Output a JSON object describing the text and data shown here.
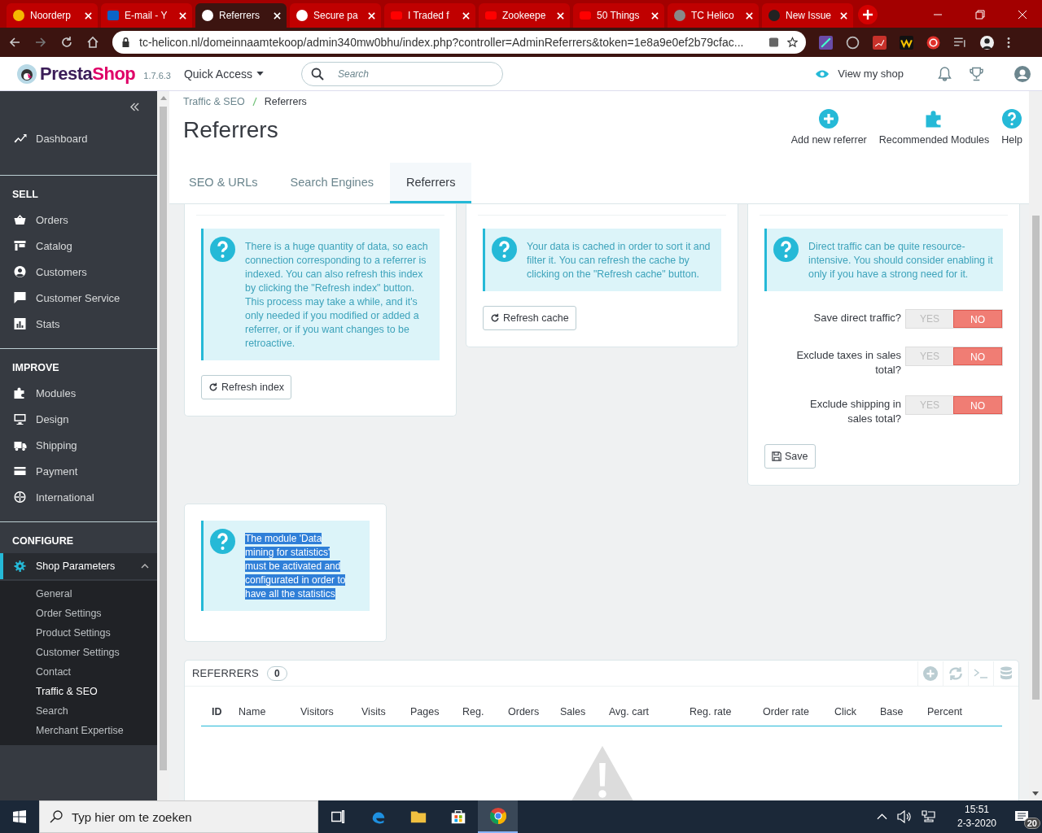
{
  "browser": {
    "tabs": [
      {
        "title": "Noorderp",
        "kind": "chat",
        "selected": false
      },
      {
        "title": "E-mail - Y",
        "kind": "mail",
        "selected": false
      },
      {
        "title": "Referrers",
        "kind": "bird",
        "selected": true
      },
      {
        "title": "Secure pa",
        "kind": "bird",
        "selected": false
      },
      {
        "title": "I Traded f",
        "kind": "play",
        "selected": false
      },
      {
        "title": "Zookeepe",
        "kind": "play",
        "selected": false
      },
      {
        "title": "50 Things",
        "kind": "play",
        "selected": false
      },
      {
        "title": "TC Helico",
        "kind": "globe",
        "selected": false
      },
      {
        "title": "New Issue",
        "kind": "octo",
        "selected": false
      }
    ],
    "address": "tc-helicon.nl/domeinnaamtekoop/admin340mw0bhu/index.php?controller=AdminReferrers&token=1e8a9e0ef2b79cfac..."
  },
  "header": {
    "logo": [
      "Presta",
      "Shop"
    ],
    "version": "1.7.6.3",
    "quick_access": "Quick Access",
    "search_placeholder": "Search",
    "view_shop": "View my shop"
  },
  "sidebar": {
    "top": [
      {
        "label": "Dashboard",
        "kind": "trend"
      }
    ],
    "sections": [
      {
        "title": "SELL",
        "items": [
          {
            "label": "Orders",
            "kind": "basket"
          },
          {
            "label": "Catalog",
            "kind": "store"
          },
          {
            "label": "Customers",
            "kind": "person"
          },
          {
            "label": "Customer Service",
            "kind": "chat"
          },
          {
            "label": "Stats",
            "kind": "stats"
          }
        ]
      },
      {
        "title": "IMPROVE",
        "items": [
          {
            "label": "Modules",
            "kind": "puzzle"
          },
          {
            "label": "Design",
            "kind": "monitor"
          },
          {
            "label": "Shipping",
            "kind": "truck"
          },
          {
            "label": "Payment",
            "kind": "card"
          },
          {
            "label": "International",
            "kind": "globe"
          }
        ]
      },
      {
        "title": "CONFIGURE",
        "items": [
          {
            "label": "Shop Parameters",
            "kind": "gear",
            "expanded": true,
            "children": [
              {
                "label": "General",
                "selected": false
              },
              {
                "label": "Order Settings",
                "selected": false
              },
              {
                "label": "Product Settings",
                "selected": false
              },
              {
                "label": "Customer Settings",
                "selected": false
              },
              {
                "label": "Contact",
                "selected": false
              },
              {
                "label": "Traffic & SEO",
                "selected": true
              },
              {
                "label": "Search",
                "selected": false
              },
              {
                "label": "Merchant Expertise",
                "selected": false
              }
            ]
          }
        ]
      }
    ]
  },
  "page": {
    "breadcrumb": [
      "Traffic & SEO",
      "Referrers"
    ],
    "title": "Referrers",
    "toolbar": [
      {
        "label": "Add new referrer",
        "kind": "add"
      },
      {
        "label": "Recommended Modules",
        "kind": "modules"
      },
      {
        "label": "Help",
        "kind": "help"
      }
    ],
    "tabs": [
      {
        "label": "SEO & URLs",
        "selected": false
      },
      {
        "label": "Search Engines",
        "selected": false
      },
      {
        "label": "Referrers",
        "selected": true
      }
    ]
  },
  "indexing": {
    "info": "There is a huge quantity of data, so each connection corresponding to a referrer is indexed. You can also refresh this index by clicking the \"Refresh index\" button. This process may take a while, and it's only needed if you modified or added a referrer, or if you want changes to be retroactive.",
    "button": "Refresh index"
  },
  "cache": {
    "info": "Your data is cached in order to sort it and filter it. You can refresh the cache by clicking on the \"Refresh cache\" button.",
    "button": "Refresh cache"
  },
  "settings": {
    "info": "Direct traffic can be quite resource-intensive. You should consider enabling it only if you have a strong need for it.",
    "fields": [
      {
        "label": "Save direct traffic?",
        "yes": "YES",
        "no": "NO",
        "on": false
      },
      {
        "label": "Exclude taxes in sales total?",
        "yes": "YES",
        "no": "NO",
        "on": false
      },
      {
        "label": "Exclude shipping in sales total?",
        "yes": "YES",
        "no": "NO",
        "on": false
      }
    ],
    "button": "Save"
  },
  "module_notice": {
    "info": "The module 'Data mining for statistics' must be activated and configurated in order to have all the statistics",
    "highlighted": true
  },
  "referrers": {
    "title": "REFERRERS",
    "count": "0",
    "columns": [
      "ID",
      "Name",
      "Visitors",
      "Visits",
      "Pages",
      "Reg.",
      "Orders",
      "Sales",
      "Avg. cart",
      "Reg. rate",
      "Order rate",
      "Click",
      "Base",
      "Percent"
    ]
  },
  "taskbar": {
    "search_placeholder": "Typ hier om te zoeken",
    "apps": [
      {
        "kind": "taskview",
        "selected": false
      },
      {
        "kind": "edge",
        "selected": false
      },
      {
        "kind": "folder",
        "selected": false
      },
      {
        "kind": "store",
        "selected": false
      },
      {
        "kind": "chrome",
        "selected": true
      }
    ],
    "time": "15:51",
    "date": "2-3-2020",
    "notifications": "20"
  }
}
